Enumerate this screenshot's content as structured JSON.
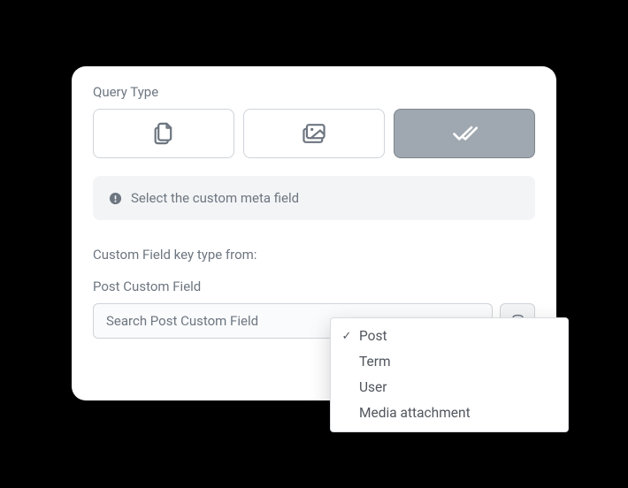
{
  "section_label": "Query Type",
  "query_types": {
    "posts": "posts-icon",
    "media": "media-icon",
    "custom": "double-check-icon"
  },
  "info": {
    "text": "Select the custom meta field"
  },
  "custom_field_key_label": "Custom Field key type from:",
  "post_custom_field_label": "Post Custom Field",
  "search_placeholder": "Search Post Custom Field",
  "dropdown": {
    "selected": "Post",
    "items": [
      "Post",
      "Term",
      "User",
      "Media attachment"
    ]
  }
}
